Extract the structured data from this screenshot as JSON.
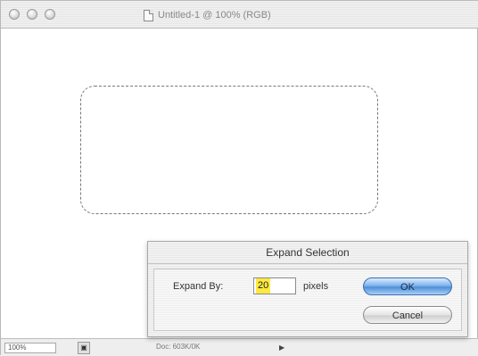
{
  "window": {
    "title": "Untitled-1 @ 100% (RGB)",
    "traffic_lights": [
      "close-button",
      "minimize-button",
      "zoom-button"
    ]
  },
  "statusbar": {
    "zoom": "100%",
    "doc_info": "Doc: 603K/0K",
    "nav_arrow": "▶",
    "status_button": "▣"
  },
  "dialog": {
    "title": "Expand Selection",
    "expand_label": "Expand By:",
    "expand_value": "20",
    "unit": "pixels",
    "ok_label": "OK",
    "cancel_label": "Cancel"
  },
  "colors": {
    "ok_button": "#4e8fd8",
    "input_highlight": "#ffe940"
  }
}
